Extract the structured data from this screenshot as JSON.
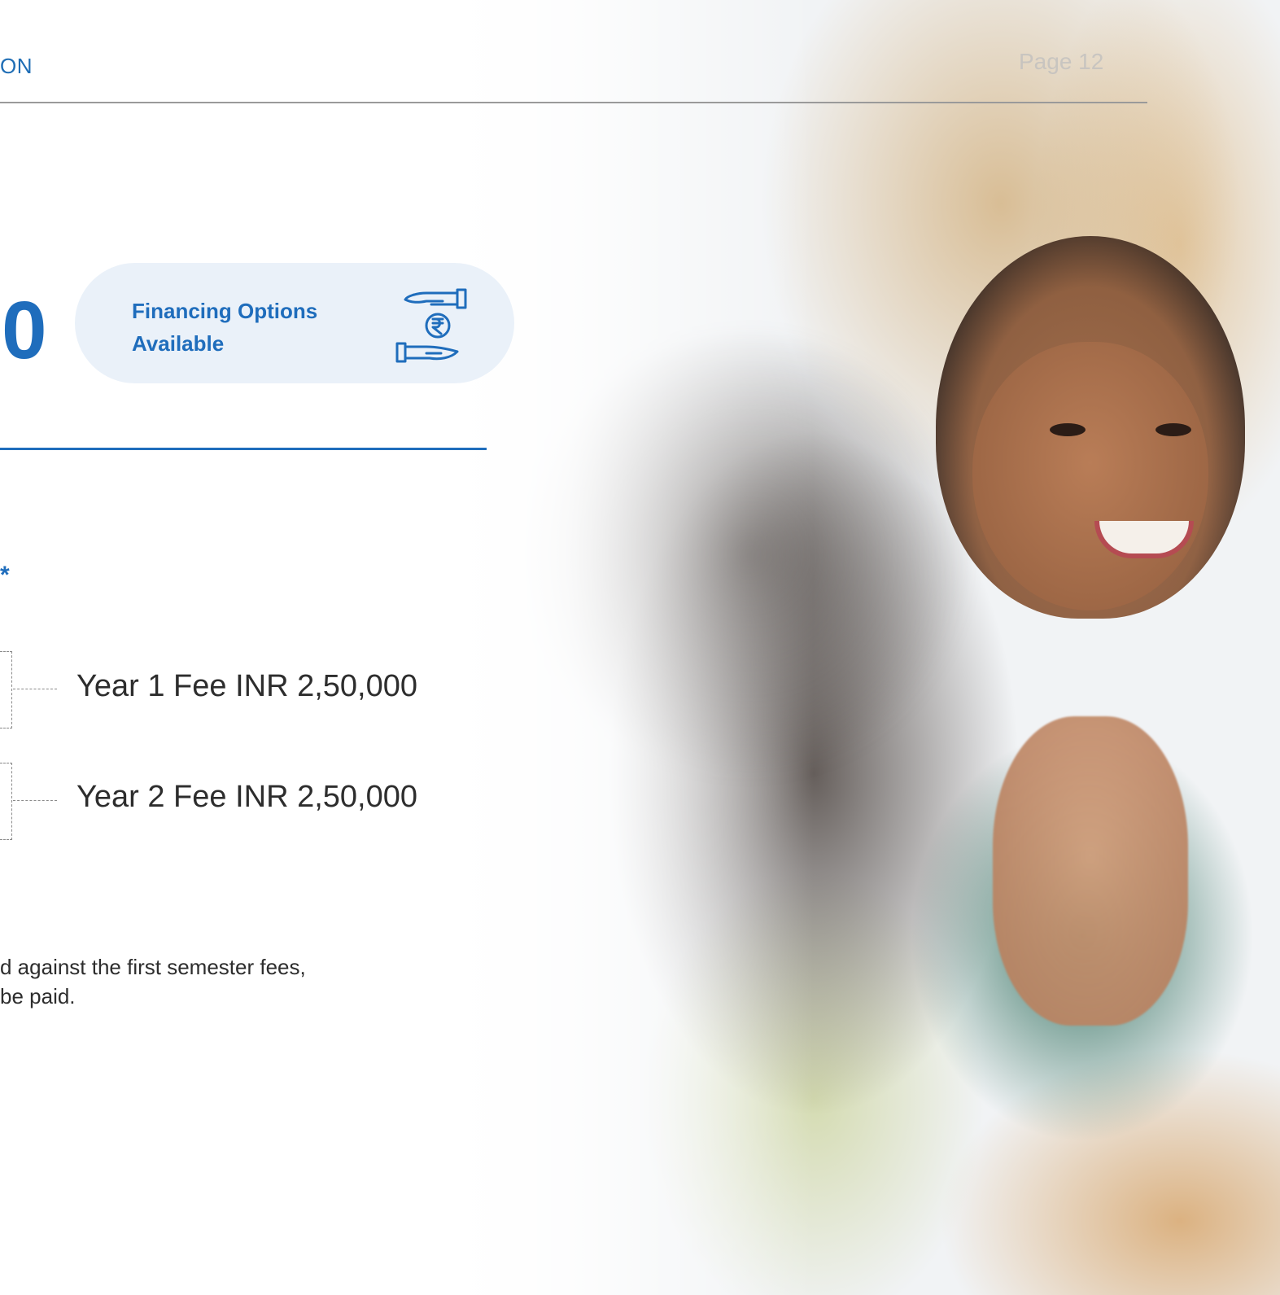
{
  "header": {
    "section_label": "ON",
    "page_label": "Page 12"
  },
  "fee_highlight": {
    "big_digit": "0",
    "financing_line1": "Financing Options",
    "financing_line2": "Available",
    "icon": "hand-rupee-icon"
  },
  "fees": {
    "asterisk": "*",
    "year1": "Year 1 Fee INR 2,50,000",
    "year2": "Year 2 Fee INR 2,50,000"
  },
  "note": {
    "line1": "d against the first semester fees,",
    "line2": "be paid."
  },
  "colors": {
    "accent": "#1f6dbc",
    "pill_bg": "#eaf1f9",
    "text": "#2d2d2d"
  }
}
